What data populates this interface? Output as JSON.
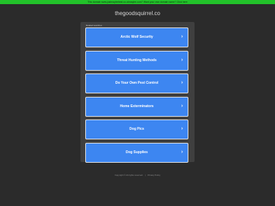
{
  "banner": {
    "text": "This domain www.justmaybebest.co.ukmaybe.com? Want your own domain name? Click here"
  },
  "site": {
    "domain": "thegoodsquirrel.co"
  },
  "related": {
    "heading": "Related searches",
    "chevron_icon": "chevron-right-icon",
    "links": [
      {
        "label": "Arctic Wolf Security"
      },
      {
        "label": "Threat Hunting Methods"
      },
      {
        "label": "Do Your Own Pest Control"
      },
      {
        "label": "Home Exterminators"
      },
      {
        "label": "Dog Pics"
      },
      {
        "label": "Dog Supplies"
      }
    ]
  },
  "footer": {
    "copyright": "Copyright © All rights reserved.",
    "separator": "|",
    "privacy": "Privacy Policy"
  },
  "colors": {
    "banner": "#22c22a",
    "background": "#2b2b2b",
    "panel": "#3f3f3f",
    "link": "#3d86f1",
    "link_border": "#e6e6e6"
  }
}
